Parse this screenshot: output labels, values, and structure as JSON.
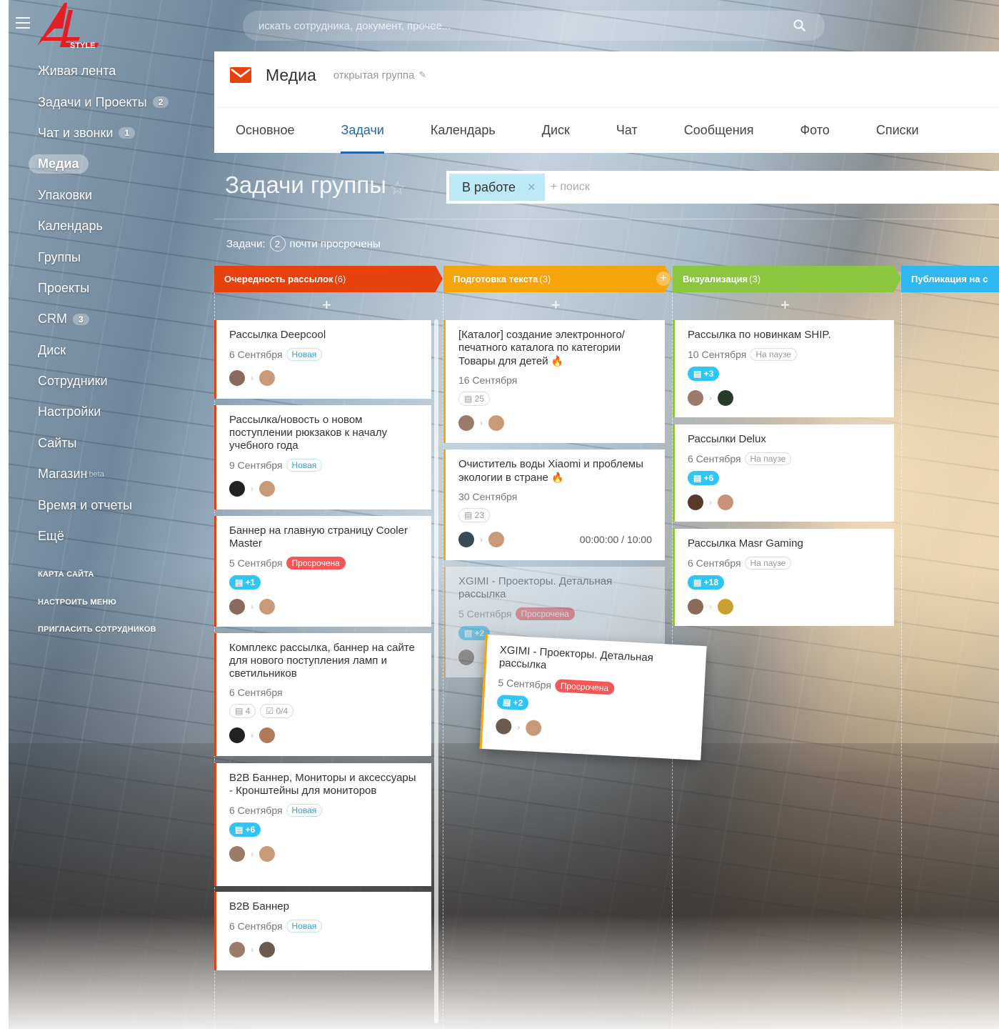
{
  "search": {
    "placeholder": "искать сотрудника, документ, прочее..."
  },
  "logo": {
    "text": "STYLE"
  },
  "menu": [
    {
      "label": "Живая лента",
      "counter": ""
    },
    {
      "label": "Задачи и Проекты",
      "counter": "2"
    },
    {
      "label": "Чат и звонки",
      "counter": "1"
    },
    {
      "label": "Медиа",
      "counter": "",
      "active": true
    },
    {
      "label": "Упаковки",
      "counter": ""
    },
    {
      "label": "Календарь",
      "counter": ""
    },
    {
      "label": "Группы",
      "counter": ""
    },
    {
      "label": "Проекты",
      "counter": ""
    },
    {
      "label": "CRM",
      "counter": "3"
    },
    {
      "label": "Диск",
      "counter": ""
    },
    {
      "label": "Сотрудники",
      "counter": ""
    },
    {
      "label": "Настройки",
      "counter": ""
    },
    {
      "label": "Сайты",
      "counter": ""
    },
    {
      "label": "Магазин",
      "counter": "",
      "beta": "beta"
    },
    {
      "label": "Время и отчеты",
      "counter": ""
    },
    {
      "label": "Ещё",
      "counter": ""
    }
  ],
  "menu_small": [
    "КАРТА САЙТА",
    "НАСТРОИТЬ МЕНЮ",
    "ПРИГЛАСИТЬ СОТРУДНИКОВ"
  ],
  "group": {
    "name": "Медиа",
    "type": "открытая группа"
  },
  "tabs": [
    "Основное",
    "Задачи",
    "Календарь",
    "Диск",
    "Чат",
    "Сообщения",
    "Фото",
    "Списки"
  ],
  "page_title": "Задачи группы",
  "filter": {
    "chip": "В работе",
    "search": "+ поиск"
  },
  "tasks_counter": {
    "label": "Задачи:",
    "count": "2",
    "text": "почти просрочены"
  },
  "columns": [
    {
      "title": "Очередность рассылок",
      "count": "(6)",
      "color": "#e8420c"
    },
    {
      "title": "Подготовка текста",
      "count": "(3)",
      "color": "#f6a40a"
    },
    {
      "title": "Визуализация",
      "count": "(3)",
      "color": "#8cc63f"
    },
    {
      "title": "Публикация на с",
      "count": "",
      "color": "#2fb8f0"
    }
  ],
  "cards": {
    "c1": [
      {
        "title": "Рассылка Deepcool",
        "date": "6 Сентября",
        "status": "Новая"
      },
      {
        "title": "Рассылка/новость о новом поступлении рюкзаков к началу учебного года",
        "date": "9 Сентября",
        "status": "Новая"
      },
      {
        "title": "Баннер на главную страницу Cooler Master",
        "date": "5 Сентября",
        "status": "Просрочена",
        "chip": "+1"
      },
      {
        "title": "Комплекс рассылка, баннер на сайте для нового поступления ламп и светильников",
        "date": "6 Сентября",
        "chip1": "4",
        "chip2": "0/4"
      },
      {
        "title": "B2B Баннер, Мониторы и аксессуары - Кронштейны для мониторов",
        "date": "6 Сентября",
        "status": "Новая",
        "chip": "+6"
      },
      {
        "title": "B2B Баннер",
        "date": "6 Сентября",
        "status": "Новая"
      }
    ],
    "c2": [
      {
        "title": "[Каталог] создание электронного/ печатного каталога по категории Товары для детей",
        "date": "16 Сентября",
        "chip": "25"
      },
      {
        "title": "Очиститель воды Xiaomi и проблемы экологии в стране",
        "date": "30 Сентября",
        "chip": "23",
        "timer": "00:00:00 / 10:00"
      },
      {
        "title": "XGIMI - Проекторы. Детальная рассылка",
        "date": "5 Сентября",
        "status": "Просрочена",
        "chip": "+2"
      }
    ],
    "c3": [
      {
        "title": "Рассылка по новинкам SHIP.",
        "date": "10 Сентября",
        "status": "На паузе",
        "chip": "+3"
      },
      {
        "title": "Рассылки Delux",
        "date": "6 Сентября",
        "status": "На паузе",
        "chip": "+6"
      },
      {
        "title": "Рассылка Masr Gaming",
        "date": "6 Сентября",
        "status": "На паузе",
        "chip": "+18"
      }
    ],
    "drag": {
      "title": "XGIMI - Проекторы. Детальная рассылка",
      "date": "5 Сентября",
      "status": "Просрочена",
      "chip": "+2"
    }
  },
  "colors": {
    "accent": "#2067b0",
    "overdue": "#f55656",
    "new": "#2fa1d8"
  }
}
